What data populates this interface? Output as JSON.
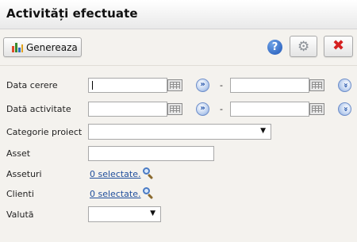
{
  "window": {
    "title": "Activități efectuate"
  },
  "toolbar": {
    "generate_label": "Genereaza",
    "help_symbol": "?",
    "settings_icon": "gear-icon",
    "close_icon": "close-icon"
  },
  "form": {
    "data_cerere": {
      "label": "Data cerere",
      "from_value": "",
      "to_value": "",
      "separator": "-",
      "shift_symbol": "»",
      "expand_symbol": "»"
    },
    "data_activitate": {
      "label": "Dată activitate",
      "from_value": "",
      "to_value": "",
      "separator": "-",
      "shift_symbol": "»",
      "expand_symbol": "»"
    },
    "categorie_proiect": {
      "label": "Categorie proiect",
      "selected": ""
    },
    "asset": {
      "label": "Asset",
      "value": ""
    },
    "asseturi": {
      "label": "Asseturi",
      "link": "0 selectate."
    },
    "clienti": {
      "label": "Clienti",
      "link": "0 selectate."
    },
    "valuta": {
      "label": "Valută",
      "selected": ""
    }
  },
  "colors": {
    "accent_blue": "#1f56b8",
    "close_red": "#d52020",
    "link": "#1f4e9c"
  }
}
